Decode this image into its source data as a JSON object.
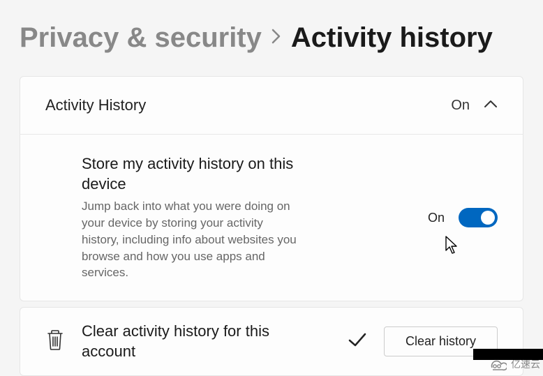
{
  "breadcrumb": {
    "parent": "Privacy & security",
    "current": "Activity history"
  },
  "activity_card": {
    "header_title": "Activity History",
    "header_state": "On",
    "setting_title": "Store my activity history on this device",
    "setting_desc": "Jump back into what you were doing on your device by storing your activity history, including info about websites you browse and how you use apps and services.",
    "toggle_label": "On",
    "toggle_on": true
  },
  "clear_card": {
    "title": "Clear activity history for this account",
    "button_label": "Clear history"
  },
  "watermark": "亿速云",
  "colors": {
    "accent": "#0067c0"
  }
}
